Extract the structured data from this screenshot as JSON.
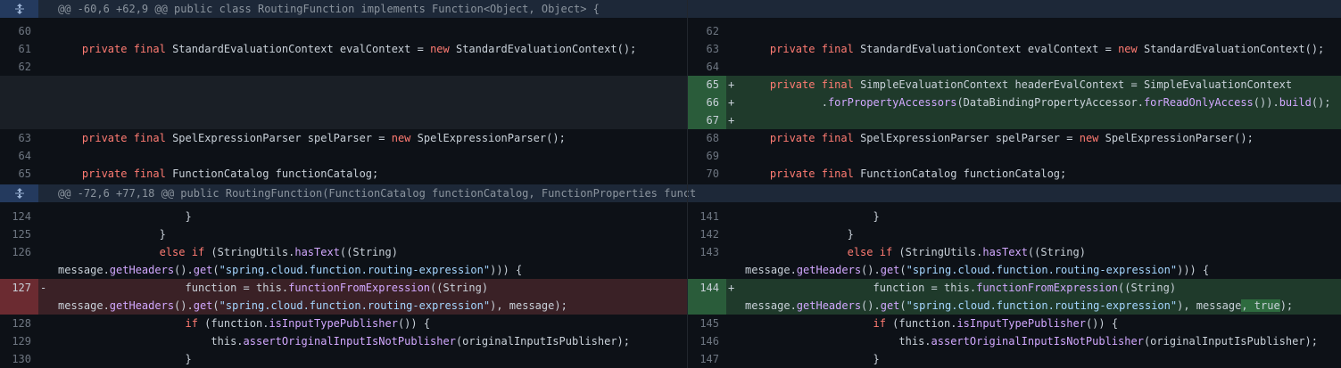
{
  "hunks": [
    {
      "header": "@@ -60,6 +62,9 @@ public class RoutingFunction implements Function<Object, Object> {"
    },
    {
      "header": "@@ -72,6 +77,18 @@ public RoutingFunction(FunctionCatalog functionCatalog, FunctionProperties funct"
    }
  ],
  "left": {
    "lines": [
      "60",
      "61",
      "62",
      "63",
      "64",
      "65",
      "124",
      "125",
      "126",
      "127",
      "128",
      "129",
      "130"
    ]
  },
  "right": {
    "lines": [
      "62",
      "63",
      "64",
      "65",
      "66",
      "67",
      "68",
      "69",
      "70",
      "141",
      "142",
      "143",
      "144",
      "145",
      "146",
      "147"
    ]
  },
  "code": {
    "priv": "private",
    "final": "final",
    "new": "new",
    "else": "else",
    "if": "if",
    "sec_type": " StandardEvaluationContext evalContext = ",
    "sec_ctor": "StandardEvaluationContext();",
    "hec_type": " SimpleEvaluationContext headerEvalContext = SimpleEvaluationContext",
    "for_prop": "forPropertyAccessors",
    "dbpa": "(DataBindingPropertyAccessor.",
    "for_ro": "forReadOnlyAccess",
    "build_a": "()).",
    "build": "build",
    "build_b": "();",
    "sep_type": " SpelExpressionParser spelParser = ",
    "sep_ctor": "SpelExpressionParser();",
    "fc": " FunctionCatalog functionCatalog;",
    "brace": "}",
    "stringutils": " (StringUtils.",
    "hastext": "hasText",
    "cast": "((String)",
    "msg": "message.",
    "getHeaders": "getHeaders",
    "get_a": "().",
    "get": "get",
    "routing_str": "\"spring.cloud.function.routing-expression\"",
    "close_brace": "))) {",
    "fn_assign": "function = this.",
    "ffe": "functionFromExpression",
    "close_msg": "), message);",
    "close_msg_r": "), message",
    "true_add": ", true",
    "close_end": ");",
    "if_a": " (function.",
    "isinput": "isInputTypePublisher",
    "if_b": "()) {",
    "this_a": "this.",
    "assert": "assertOriginalInputIsNotPublisher",
    "assert_b": "(originalInputIsPublisher);",
    "plus": "+",
    "minus": "-",
    "dot": "."
  }
}
